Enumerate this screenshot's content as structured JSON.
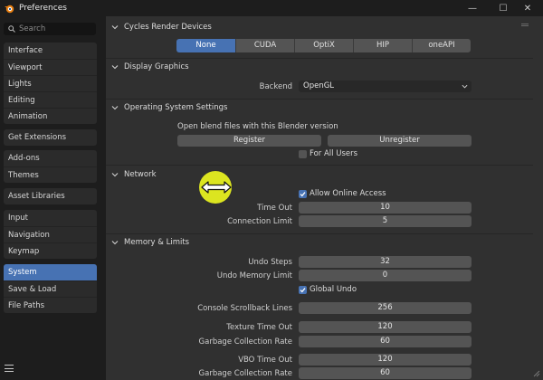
{
  "window": {
    "title": "Preferences",
    "minimize": "—",
    "maximize": "☐",
    "close": "✕"
  },
  "sidebar": {
    "search_placeholder": "Search",
    "groups": [
      [
        "Interface",
        "Viewport",
        "Lights",
        "Editing",
        "Animation"
      ],
      [
        "Get Extensions"
      ],
      [
        "Add-ons",
        "Themes"
      ],
      [
        "Asset Libraries"
      ],
      [
        "Input",
        "Navigation",
        "Keymap"
      ],
      [
        "System",
        "Save & Load",
        "File Paths"
      ]
    ],
    "active": "System"
  },
  "cycles": {
    "header": "Cycles Render Devices",
    "options": [
      "None",
      "CUDA",
      "OptiX",
      "HIP",
      "oneAPI"
    ],
    "selected": "None"
  },
  "display": {
    "header": "Display Graphics",
    "backend_label": "Backend",
    "backend_value": "OpenGL"
  },
  "os": {
    "header": "Operating System Settings",
    "open_text": "Open blend files with this Blender version",
    "register": "Register",
    "unregister": "Unregister",
    "for_all_users": "For All Users"
  },
  "network": {
    "header": "Network",
    "online_access": "Allow Online Access",
    "timeout_label": "Time Out",
    "timeout_value": "10",
    "conn_label": "Connection Limit",
    "conn_value": "5"
  },
  "memory": {
    "header": "Memory & Limits",
    "rows": [
      {
        "label": "Undo Steps",
        "value": "32"
      },
      {
        "label": "Undo Memory Limit",
        "value": "0"
      },
      {
        "label": "Console Scrollback Lines",
        "value": "256"
      },
      {
        "label": "Texture Time Out",
        "value": "120"
      },
      {
        "label": "Garbage Collection Rate",
        "value": "60"
      },
      {
        "label": "VBO Time Out",
        "value": "120"
      },
      {
        "label": "Garbage Collection Rate",
        "value": "60"
      }
    ],
    "global_undo": "Global Undo"
  },
  "colors": {
    "accent": "#4772b3",
    "panel": "#303030",
    "field": "#545454",
    "cursor": "#e6ef20"
  }
}
